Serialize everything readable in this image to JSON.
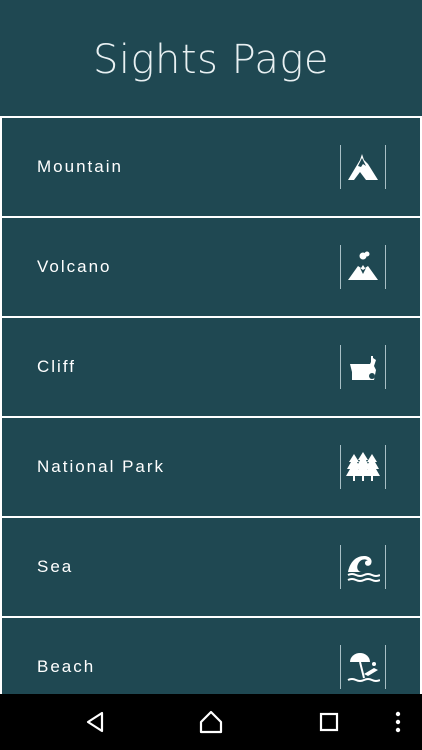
{
  "header": {
    "title": "Sights Page"
  },
  "sights": [
    {
      "label": "Mountain",
      "icon": "mountain-icon"
    },
    {
      "label": "Volcano",
      "icon": "volcano-icon"
    },
    {
      "label": "Cliff",
      "icon": "cliff-icon"
    },
    {
      "label": "National Park",
      "icon": "national-park-icon"
    },
    {
      "label": "Sea",
      "icon": "sea-icon"
    },
    {
      "label": "Beach",
      "icon": "beach-icon"
    }
  ],
  "navbar": {
    "back": "back-icon",
    "home": "home-icon",
    "recents": "recents-icon",
    "menu": "menu-icon"
  },
  "colors": {
    "background": "#1f4852",
    "divider": "#ffffff",
    "text": "#ffffff",
    "navbar": "#000000"
  }
}
